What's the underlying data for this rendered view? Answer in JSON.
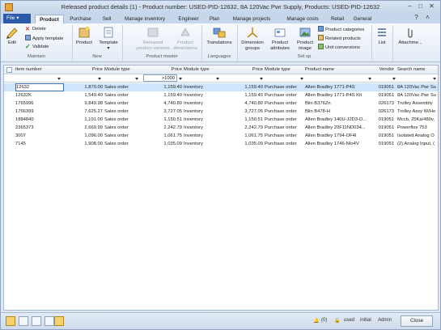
{
  "window": {
    "title": "Released product details (1) - Product number: USED-PID-12632, 8A 120Vac Pwr Supply, Products: USED-PID-12632"
  },
  "ribbon": {
    "file_label": "File",
    "tabs": [
      "Product",
      "Purchase",
      "Sell",
      "Manage inventory",
      "Engineer",
      "Plan",
      "Manage projects",
      "Manage costs",
      "Retail",
      "General"
    ],
    "maintain": {
      "group": "Maintain",
      "edit": "Edit",
      "delete": "Delete",
      "apply_template": "Apply template",
      "validate": "Validate"
    },
    "new": {
      "group": "New",
      "product": "Product",
      "template": "Template"
    },
    "product_master": {
      "group": "Product master",
      "released_variants": "Released product variants",
      "product_dimensions": "Product dimensions"
    },
    "languages": {
      "group": "Languages",
      "translations": "Translations"
    },
    "setup": {
      "group": "Set up",
      "dimension_groups": "Dimension groups",
      "product_attributes": "Product attributes",
      "product_image": "Product image",
      "product_categories": "Product categories",
      "related_products": "Related products",
      "unit_conversions": "Unit conversions"
    },
    "list": "List",
    "attachments": "Attachme..."
  },
  "grid": {
    "columns": [
      "Item number",
      "Price",
      "Module type",
      "Price",
      "Module type",
      "Price",
      "Module type",
      "Product name",
      "Vendor",
      "Search name"
    ],
    "filter_value": ">1000",
    "rows": [
      [
        "12632",
        "1,870.00",
        "Sales order",
        "1,159.40",
        "Inventory",
        "1,159.40",
        "Purchase order",
        "Allen Bradley 1771-P4S",
        "019051",
        "8A 120Vac Pwr Su"
      ],
      [
        "12632K",
        "1,549.40",
        "Sales order",
        "1,159.40",
        "Inventory",
        "1,159.40",
        "Purchase order",
        "Allen Bradley 1771-P4S Kit",
        "019051",
        "8A 120Vac Pwr Su"
      ],
      [
        "1765996",
        "9,849.98",
        "Sales order",
        "4,740.80",
        "Inventory",
        "4,740.80",
        "Purchase order",
        "Blin B376Zn",
        "026173",
        "Trolley Assembly"
      ],
      [
        "1766399",
        "7,625.27",
        "Sales order",
        "3,727.05",
        "Inventory",
        "3,727.05",
        "Purchase order",
        "Blin B478-H",
        "026173",
        "Trolley Assy W/Ho"
      ],
      [
        "1884840",
        "1,191.00",
        "Sales order",
        "1,150.51",
        "Inventory",
        "1,150.51",
        "Purchase order",
        "Allen Bradley 140U-J2D3-D...",
        "019051",
        "Mccb, 25Ka/480v,"
      ],
      [
        "2365373",
        "2,669.99",
        "Sales order",
        "2,242.79",
        "Inventory",
        "2,242.79",
        "Purchase order",
        "Allen Bradley 20F11ND034...",
        "019051",
        "Powerflex 753"
      ],
      [
        "3007",
        "1,096.00",
        "Sales order",
        "1,061.75",
        "Inventory",
        "1,061.75",
        "Purchase order",
        "Allen Bradley 1794-OF4I",
        "019051",
        "Isolated Analog O"
      ],
      [
        "7145",
        "1,908.00",
        "Sales order",
        "1,035.09",
        "Inventory",
        "1,035.09",
        "Purchase order",
        "Allen Bradley 1746-NIo4V",
        "019051",
        "(2) Analog Input, ("
      ]
    ]
  },
  "status": {
    "badge": "(0)",
    "currency": "used",
    "company": "initial",
    "user": "Admin",
    "close_label": "Close"
  },
  "colors": {
    "file_tab": "#2a5aa8",
    "selection": "#cfe5fb"
  }
}
